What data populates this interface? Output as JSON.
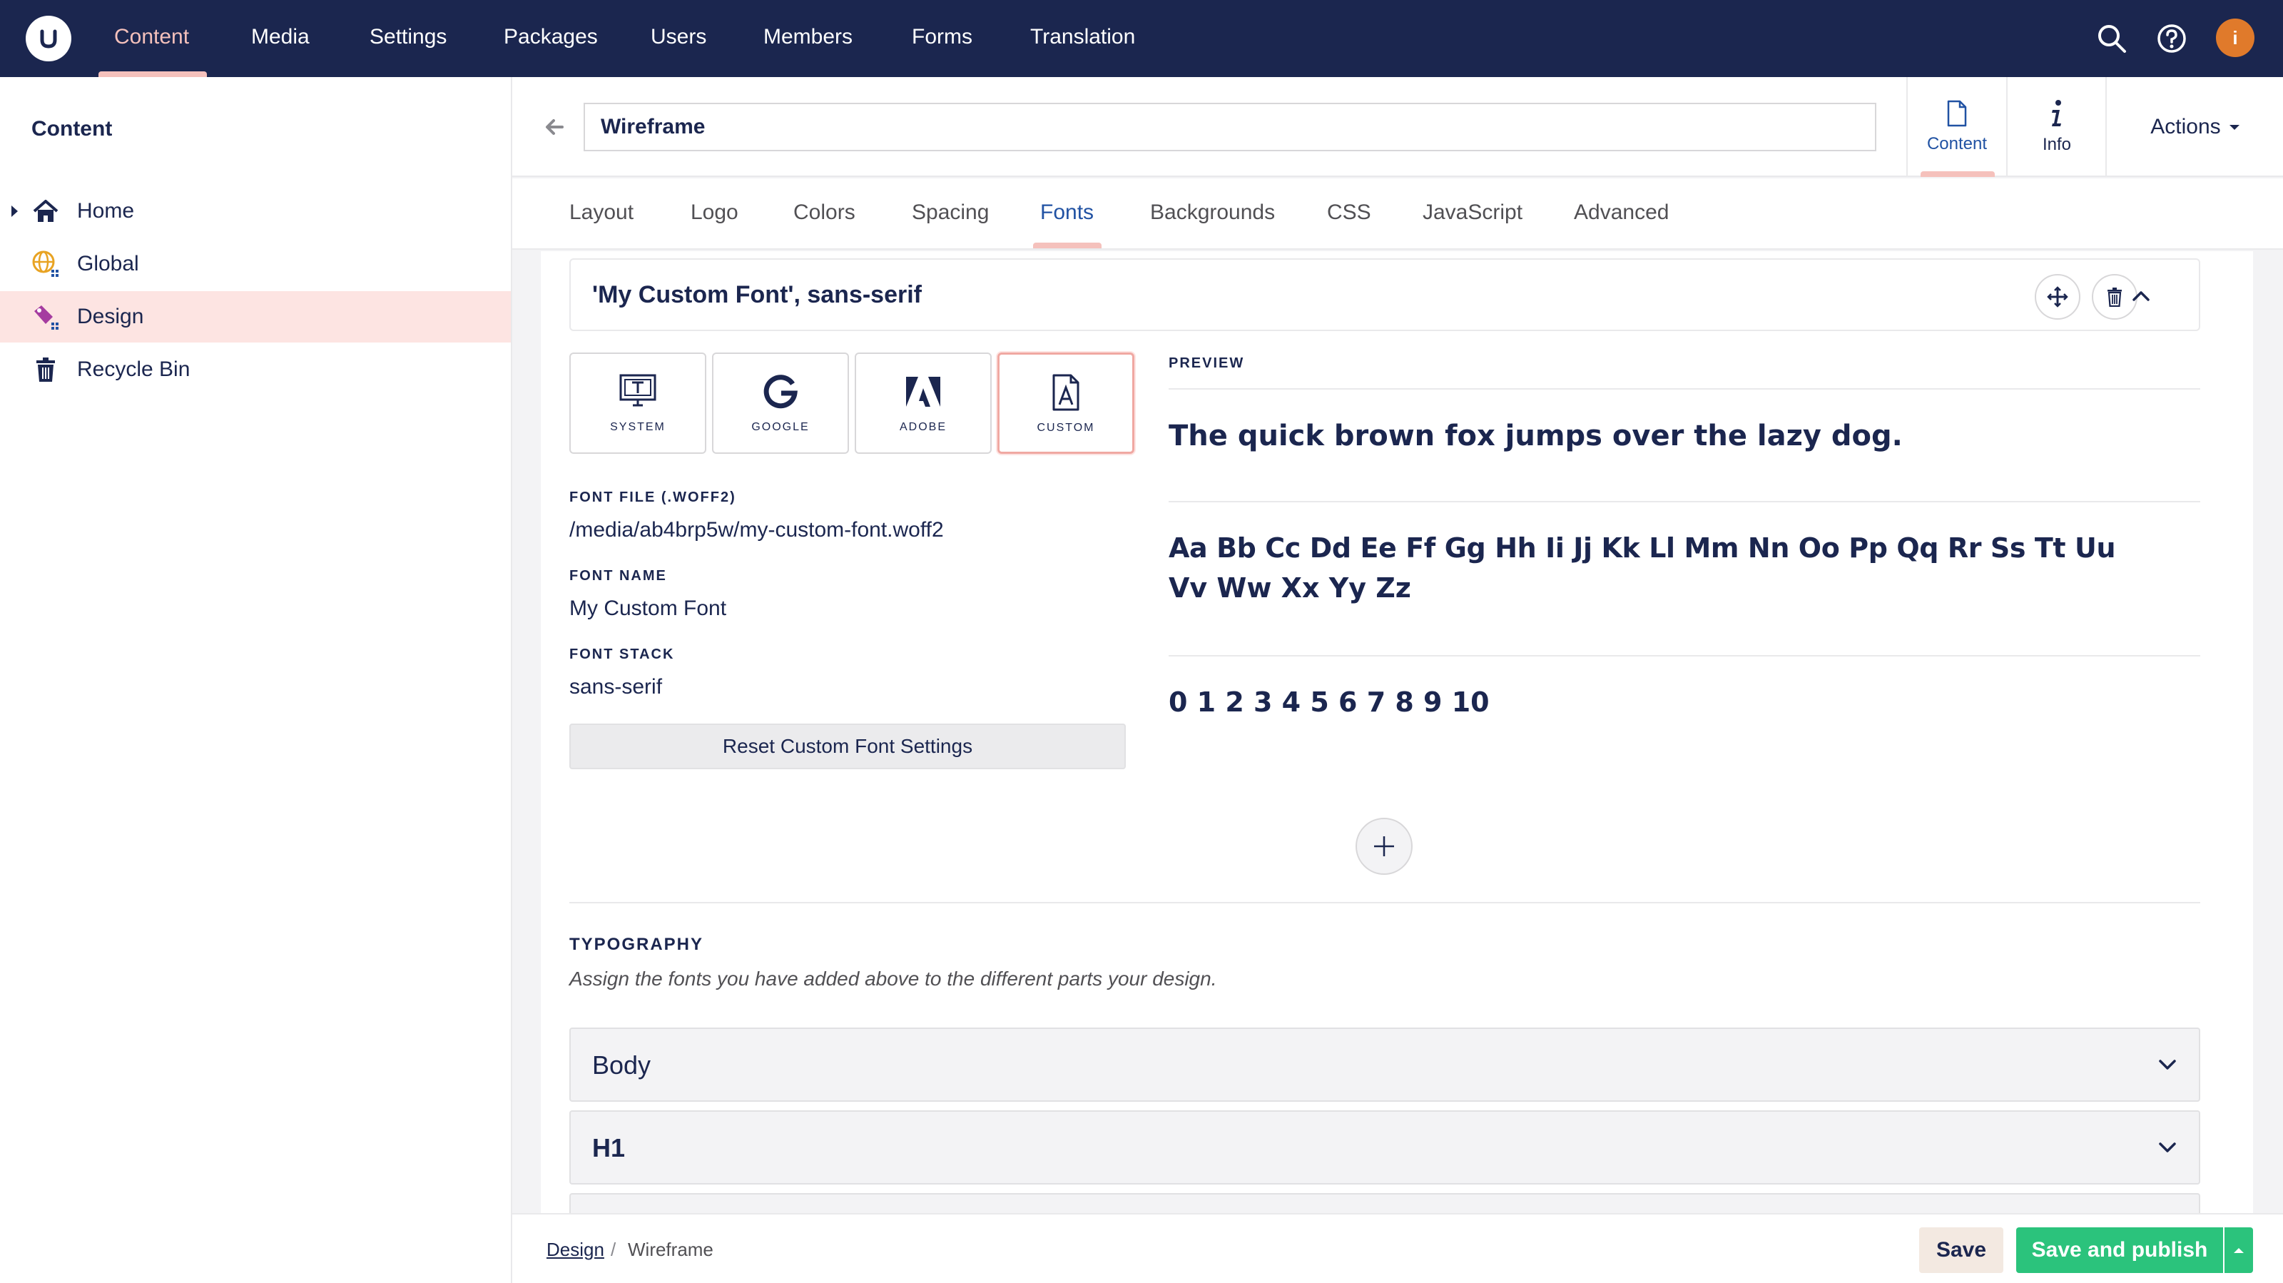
{
  "nav": {
    "items": [
      "Content",
      "Media",
      "Settings",
      "Packages",
      "Users",
      "Members",
      "Forms",
      "Translation"
    ],
    "active": "Content",
    "avatar_initial": "і"
  },
  "sidebar": {
    "title": "Content",
    "items": [
      {
        "label": "Home",
        "icon": "home-icon"
      },
      {
        "label": "Global",
        "icon": "globe-icon"
      },
      {
        "label": "Design",
        "icon": "design-icon"
      },
      {
        "label": "Recycle Bin",
        "icon": "trash-icon"
      }
    ],
    "active": "Design"
  },
  "header": {
    "name_value": "Wireframe",
    "apps": [
      {
        "label": "Content",
        "icon": "document-icon"
      },
      {
        "label": "Info",
        "icon": "info-icon"
      }
    ],
    "actions_label": "Actions"
  },
  "tabs": {
    "items": [
      "Layout",
      "Logo",
      "Colors",
      "Spacing",
      "Fonts",
      "Backgrounds",
      "CSS",
      "JavaScript",
      "Advanced"
    ],
    "active": "Fonts"
  },
  "font_block": {
    "title": "'My Custom Font', sans-serif",
    "sources": [
      "SYSTEM",
      "GOOGLE",
      "ADOBE",
      "CUSTOM"
    ],
    "selected_source": "CUSTOM",
    "fields": [
      {
        "label": "FONT FILE (.WOFF2)",
        "value": "/media/ab4brp5w/my-custom-font.woff2"
      },
      {
        "label": "FONT NAME",
        "value": "My Custom Font"
      },
      {
        "label": "FONT STACK",
        "value": "sans-serif"
      }
    ],
    "reset_label": "Reset Custom Font Settings"
  },
  "preview": {
    "label": "PREVIEW",
    "sentence": "The quick brown fox jumps over the lazy dog.",
    "alphabet_line1": "Aa Bb Cc Dd Ee Ff Gg Hh Ii Jj Kk Ll Mm Nn Oo Pp Qq Rr Ss Tt Uu",
    "alphabet_line2": "Vv Ww Xx Yy Zz",
    "digits": "0 1 2 3 4 5 6 7 8 9 10"
  },
  "typography": {
    "title": "TYPOGRAPHY",
    "description": "Assign the fonts you have added above to the different parts your design.",
    "items": [
      "Body",
      "H1"
    ]
  },
  "footer": {
    "breadcrumb_parent": "Design",
    "breadcrumb_separator": "/",
    "breadcrumb_current": "Wireframe",
    "save_label": "Save",
    "publish_label": "Save and publish"
  },
  "colors": {
    "nav_bg": "#1b264f",
    "accent_pink": "#f5c1bc",
    "active_blue": "#2152a3",
    "publish_green": "#2bc37c"
  }
}
